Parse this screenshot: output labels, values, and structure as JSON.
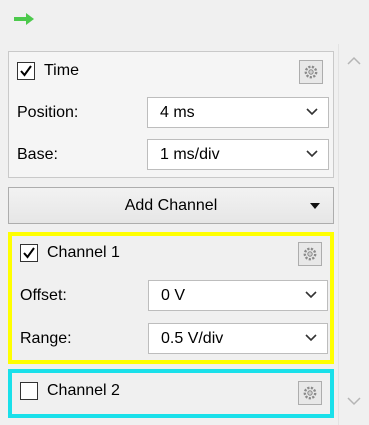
{
  "icons": {
    "top_arrow": "right-arrow-icon",
    "settings": "gear-icon",
    "dropdown": "chevron-down-icon",
    "scroll_up": "chevron-up-icon",
    "scroll_down": "chevron-down-icon",
    "add_menu": "caret-down-icon"
  },
  "colors": {
    "arrow": "#4cc94c",
    "channel1_highlight": "#ffff00",
    "channel2_highlight": "#19e0ea"
  },
  "time": {
    "label": "Time",
    "checked": true,
    "position_label": "Position:",
    "position_value": "4 ms",
    "base_label": "Base:",
    "base_value": "1 ms/div"
  },
  "add_channel": {
    "label": "Add Channel"
  },
  "channel1": {
    "label": "Channel 1",
    "checked": true,
    "offset_label": "Offset:",
    "offset_value": "0 V",
    "range_label": "Range:",
    "range_value": "0.5 V/div"
  },
  "channel2": {
    "label": "Channel 2",
    "checked": false
  }
}
